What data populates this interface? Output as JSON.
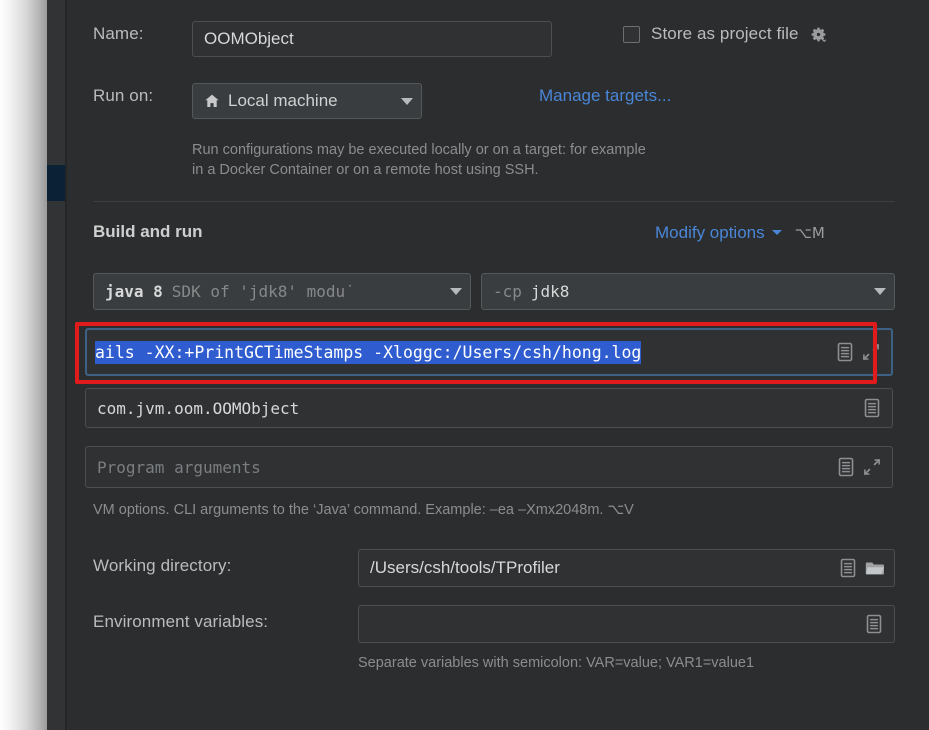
{
  "window": {
    "panel_bg": "#2b2d2e",
    "accent_link": "#4a86d8",
    "annotation_color": "#e01b1b",
    "selection_color": "#2f5dd0"
  },
  "name_row": {
    "label": "Name:",
    "value": "OOMObject",
    "store_as_project_file_label": "Store as project file",
    "store_as_project_file_checked": false,
    "gear_icon": "gear-dropdown-icon"
  },
  "run_on_row": {
    "label": "Run on:",
    "selected": "Local machine",
    "target_icon": "home-icon",
    "manage_targets_link": "Manage targets...",
    "description_line1": "Run configurations may be executed locally or on a target: for example",
    "description_line2": "in a Docker Container or on a remote host using SSH."
  },
  "build_and_run": {
    "section_title": "Build and run",
    "modify_options_label": "Modify options",
    "modify_options_shortcut": "⌥M",
    "jre_combo": {
      "primary": "java 8",
      "secondary": "SDK of 'jdk8' modu˙"
    },
    "classpath_combo": {
      "prefix": "-cp",
      "value": "jdk8"
    },
    "vm_options_field": {
      "value": "ails -XX:+PrintGCTimeStamps -Xloggc:/Users/csh/hong.log",
      "selected": true,
      "focused": true,
      "macro_icon": "macro-list-icon",
      "expand_icon": "expand-editor-icon"
    },
    "main_class_field": {
      "value": "com.jvm.oom.OOMObject",
      "macro_icon": "macro-list-icon"
    },
    "program_arguments_field": {
      "placeholder": "Program arguments",
      "value": "",
      "macro_icon": "macro-list-icon",
      "expand_icon": "expand-editor-icon"
    },
    "vm_options_hint": "VM options. CLI arguments to the ‘Java’ command. Example: –ea –Xmx2048m. ⌥V"
  },
  "working_directory": {
    "label": "Working directory:",
    "value": "/Users/csh/tools/TProfiler",
    "macro_icon": "macro-list-icon",
    "browse_icon": "folder-icon"
  },
  "environment_variables": {
    "label": "Environment variables:",
    "value": "",
    "macro_icon": "macro-list-icon",
    "hint": "Separate variables with semicolon: VAR=value; VAR1=value1"
  }
}
